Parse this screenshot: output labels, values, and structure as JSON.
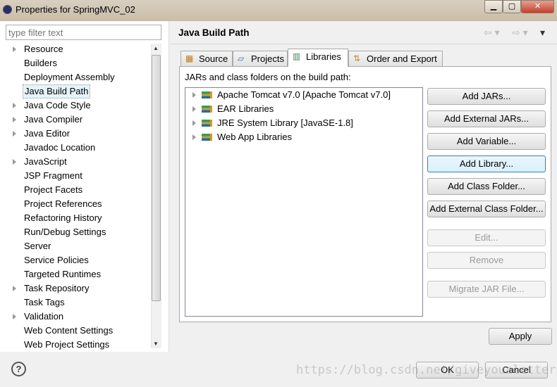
{
  "window": {
    "title": "Properties for SpringMVC_02",
    "controls": [
      "minimize",
      "maximize",
      "close"
    ]
  },
  "sidebar": {
    "filter_placeholder": "type filter text",
    "items": [
      {
        "label": "Resource",
        "expandable": true
      },
      {
        "label": "Builders",
        "expandable": false
      },
      {
        "label": "Deployment Assembly",
        "expandable": false
      },
      {
        "label": "Java Build Path",
        "expandable": false,
        "selected": true
      },
      {
        "label": "Java Code Style",
        "expandable": true
      },
      {
        "label": "Java Compiler",
        "expandable": true
      },
      {
        "label": "Java Editor",
        "expandable": true
      },
      {
        "label": "Javadoc Location",
        "expandable": false
      },
      {
        "label": "JavaScript",
        "expandable": true
      },
      {
        "label": "JSP Fragment",
        "expandable": false
      },
      {
        "label": "Project Facets",
        "expandable": false
      },
      {
        "label": "Project References",
        "expandable": false
      },
      {
        "label": "Refactoring History",
        "expandable": false
      },
      {
        "label": "Run/Debug Settings",
        "expandable": false
      },
      {
        "label": "Server",
        "expandable": false
      },
      {
        "label": "Service Policies",
        "expandable": false
      },
      {
        "label": "Targeted Runtimes",
        "expandable": false
      },
      {
        "label": "Task Repository",
        "expandable": true
      },
      {
        "label": "Task Tags",
        "expandable": false
      },
      {
        "label": "Validation",
        "expandable": true
      },
      {
        "label": "Web Content Settings",
        "expandable": false
      },
      {
        "label": "Web Project Settings",
        "expandable": false
      }
    ]
  },
  "main": {
    "title": "Java Build Path",
    "tabs": [
      {
        "label": "Source"
      },
      {
        "label": "Projects"
      },
      {
        "label": "Libraries",
        "active": true
      },
      {
        "label": "Order and Export"
      }
    ],
    "list_label": "JARs and class folders on the build path:",
    "libraries": [
      "Apache Tomcat v7.0 [Apache Tomcat v7.0]",
      "EAR Libraries",
      "JRE System Library [JavaSE-1.8]",
      "Web App Libraries"
    ],
    "buttons": {
      "add_jars": "Add JARs...",
      "add_external_jars": "Add External JARs...",
      "add_variable": "Add Variable...",
      "add_library": "Add Library...",
      "add_class_folder": "Add Class Folder...",
      "add_external_class_folder": "Add External Class Folder...",
      "edit": "Edit...",
      "remove": "Remove",
      "migrate": "Migrate JAR File..."
    },
    "apply": "Apply"
  },
  "footer": {
    "help": "?",
    "ok": "OK",
    "cancel": "Cancel"
  },
  "watermark": "https://blog.csdn.net/giveyoualetter"
}
